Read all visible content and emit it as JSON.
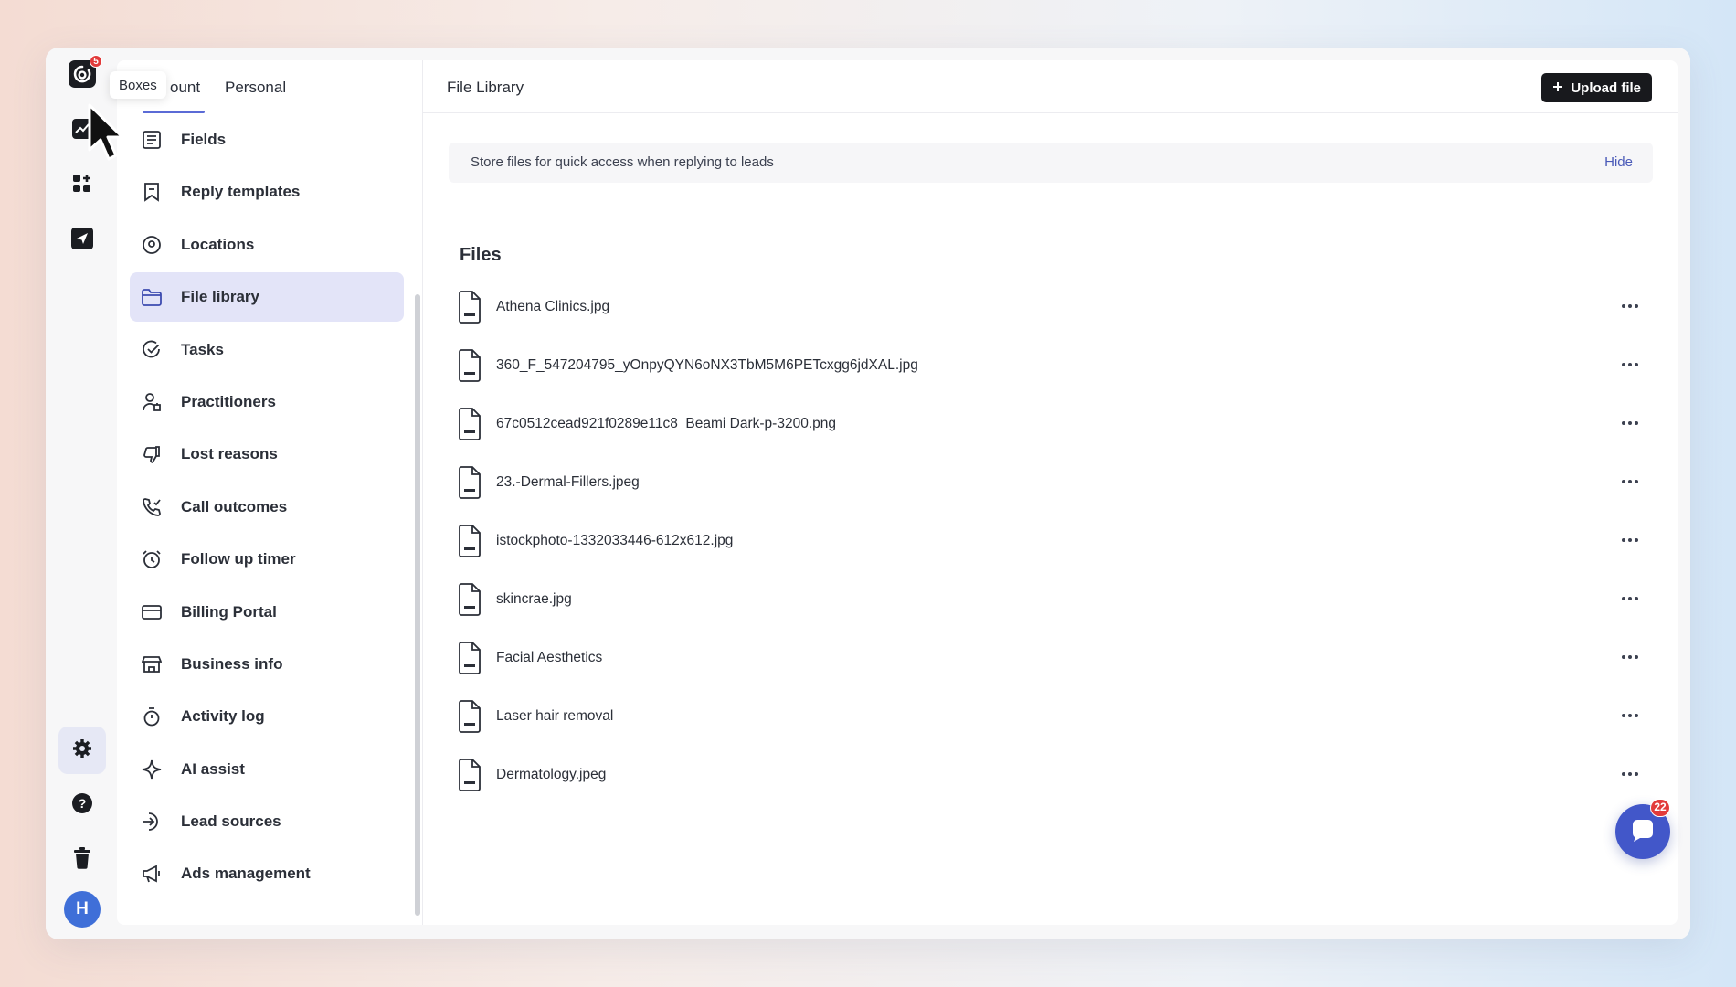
{
  "rail": {
    "logo_badge": "5",
    "avatar_initial": "H",
    "icons": [
      "logo-icon",
      "analytics-icon",
      "apps-icon",
      "send-icon",
      "settings-icon",
      "help-icon",
      "trash-icon"
    ]
  },
  "tooltip": {
    "text": "Boxes"
  },
  "tabs": [
    {
      "label": "ount"
    },
    {
      "label": "Personal"
    }
  ],
  "nav": {
    "items": [
      {
        "label": "Fields",
        "icon": "list-icon"
      },
      {
        "label": "Reply templates",
        "icon": "bookmark-icon"
      },
      {
        "label": "Locations",
        "icon": "location-pin-icon"
      },
      {
        "label": "File library",
        "icon": "folder-icon",
        "active": true
      },
      {
        "label": "Tasks",
        "icon": "check-circle-icon"
      },
      {
        "label": "Practitioners",
        "icon": "person-icon"
      },
      {
        "label": "Lost reasons",
        "icon": "thumbs-down-icon"
      },
      {
        "label": "Call outcomes",
        "icon": "phone-icon"
      },
      {
        "label": "Follow up timer",
        "icon": "alarm-icon"
      },
      {
        "label": "Billing Portal",
        "icon": "credit-card-icon"
      },
      {
        "label": "Business info",
        "icon": "store-icon"
      },
      {
        "label": "Activity log",
        "icon": "stopwatch-icon"
      },
      {
        "label": "AI assist",
        "icon": "sparkle-icon"
      },
      {
        "label": "Lead sources",
        "icon": "arrow-in-icon"
      },
      {
        "label": "Ads management",
        "icon": "megaphone-icon"
      }
    ]
  },
  "main": {
    "title": "File Library",
    "upload_label": "Upload file",
    "info_text": "Store files for quick access when replying to leads",
    "hide_label": "Hide",
    "files_heading": "Files",
    "files": [
      {
        "name": "Athena Clinics.jpg"
      },
      {
        "name": "360_F_547204795_yOnpyQYN6oNX3TbM5M6PETcxgg6jdXAL.jpg"
      },
      {
        "name": "67c0512cead921f0289e11c8_Beami Dark-p-3200.png"
      },
      {
        "name": "23.-Dermal-Fillers.jpeg"
      },
      {
        "name": "istockphoto-1332033446-612x612.jpg"
      },
      {
        "name": "skincrae.jpg"
      },
      {
        "name": "Facial Aesthetics"
      },
      {
        "name": "Laser hair removal"
      },
      {
        "name": "Dermatology.jpeg"
      }
    ]
  },
  "chat": {
    "badge": "22"
  },
  "colors": {
    "accent": "#5b6bd6",
    "active_bg": "#e3e4f8",
    "badge": "#e23b3b",
    "chat": "#4257c9",
    "avatar": "#3f6fd8"
  }
}
